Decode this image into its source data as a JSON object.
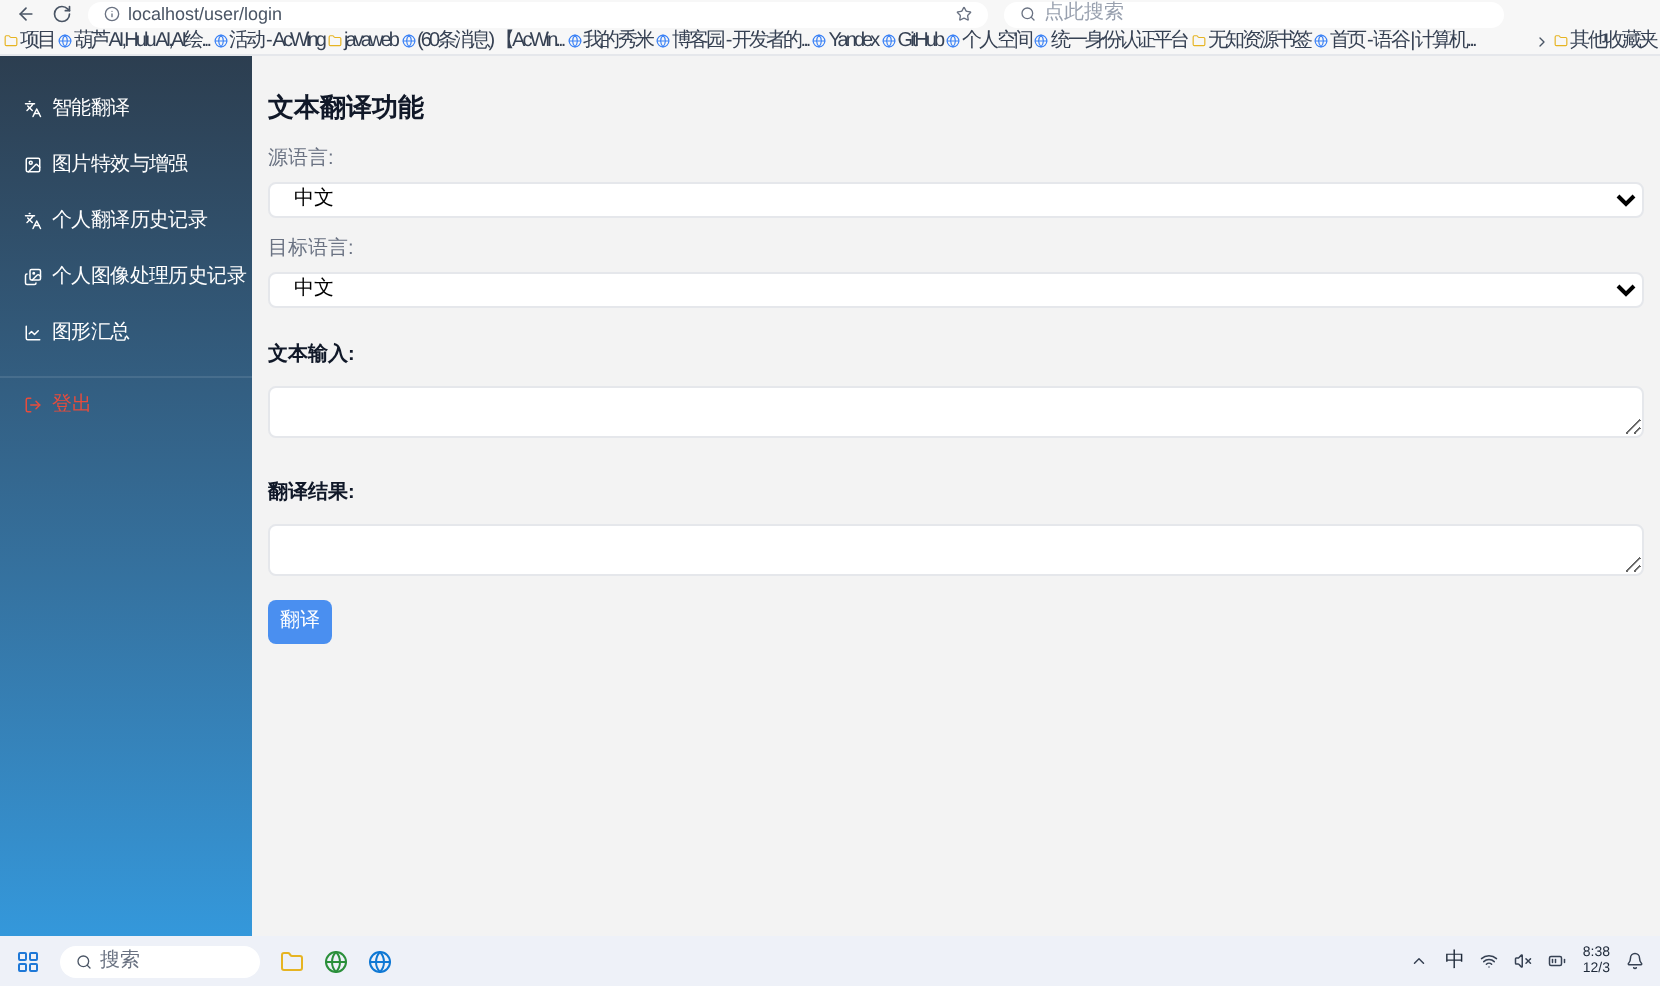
{
  "browser": {
    "address": "localhost/user/login",
    "search_placeholder": "点此搜索"
  },
  "bookmarks": [
    {
      "label": "项目",
      "kind": "folder"
    },
    {
      "label": "葫芦AI,Hulu AI,AI绘...",
      "kind": "site"
    },
    {
      "label": "活动 - AcWing",
      "kind": "site"
    },
    {
      "label": "javaweb",
      "kind": "folder"
    },
    {
      "label": "(60条消息) 【AcWin...",
      "kind": "site"
    },
    {
      "label": "我的秀米",
      "kind": "site"
    },
    {
      "label": "博客园 - 开发者的...",
      "kind": "site"
    },
    {
      "label": "Yandex",
      "kind": "site"
    },
    {
      "label": "GitHub",
      "kind": "site"
    },
    {
      "label": "个人空间",
      "kind": "site"
    },
    {
      "label": "统一身份认证平台",
      "kind": "site"
    },
    {
      "label": "无知资源书签",
      "kind": "folder"
    },
    {
      "label": "首页 - 语谷 | 计算机...",
      "kind": "site"
    }
  ],
  "other_bookmarks": "其他收藏夹",
  "sidebar": {
    "items": [
      {
        "label": "智能翻译",
        "kind": "translate"
      },
      {
        "label": "图片特效与增强",
        "kind": "image"
      },
      {
        "label": "个人翻译历史记录",
        "kind": "translate"
      },
      {
        "label": "个人图像处理历史记录",
        "kind": "images"
      },
      {
        "label": "图形汇总",
        "kind": "chart"
      }
    ],
    "logout": "登出"
  },
  "main": {
    "title": "文本翻译功能",
    "source_label": "源语言:",
    "source_value": "中文",
    "target_label": "目标语言:",
    "target_value": "中文",
    "input_label": "文本输入:",
    "result_label": "翻译结果:",
    "button": "翻译"
  },
  "taskbar": {
    "search_placeholder": "搜索",
    "ime": "中",
    "time": "8:38",
    "date": "12/3"
  }
}
